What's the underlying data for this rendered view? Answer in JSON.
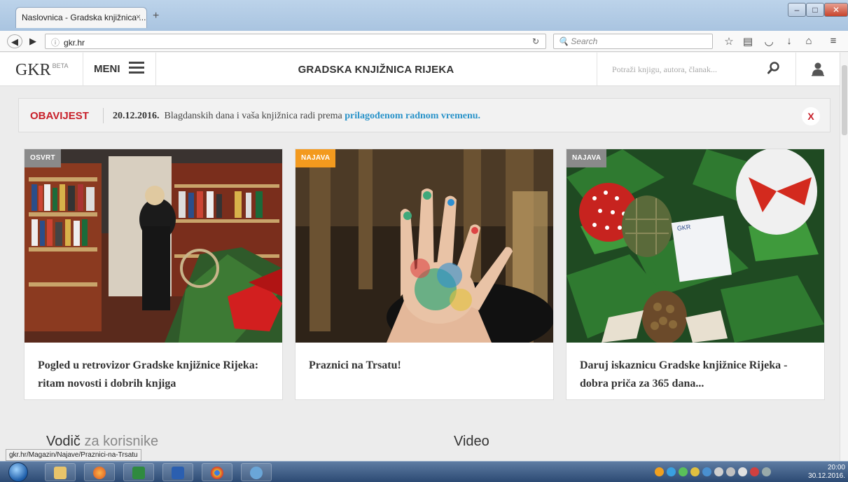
{
  "browser": {
    "tab_title": "Naslovnica - Gradska knjižnica ...",
    "tab_close": "×",
    "new_tab": "+",
    "url": "gkr.hr",
    "search_placeholder": "Search",
    "status_url": "gkr.hr/Magazin/Najave/Praznici-na-Trsatu"
  },
  "header": {
    "logo": "GKR",
    "logo_badge": "BETA",
    "menu_label": "MENI",
    "site_title": "GRADSKA KNJIŽNICA RIJEKA",
    "search_placeholder": "Potraži knjigu, autora, članak..."
  },
  "notice": {
    "label": "OBAVIJEST",
    "date": "20.12.2016.",
    "text": "Blagdanskih dana i vaša knjižnica radi prema",
    "link": "prilagođenom radnom vremenu.",
    "close": "X"
  },
  "cards": [
    {
      "tag": "OSVRT",
      "tag_color": "#8a8a8a",
      "title": "Pogled u retrovizor Gradske knjižnice Rijeka: ritam novosti i dobrih knjiga"
    },
    {
      "tag": "NAJAVA",
      "tag_color": "#f39a1e",
      "title": "Praznici na Trsatu!"
    },
    {
      "tag": "NAJAVA",
      "tag_color": "#8a8a8a",
      "title": "Daruj iskaznicu Gradske knjižnice Rijeka - dobra priča za 365 dana..."
    }
  ],
  "sections": {
    "guide_bold": "Vodič",
    "guide_light": " za korisnike",
    "video": "Video"
  },
  "taskbar": {
    "time": "20:00",
    "date": "30.12.2016."
  },
  "colors": {
    "accent_red": "#c8202a",
    "link_blue": "#2a93c9",
    "tag_orange": "#f39a1e"
  }
}
